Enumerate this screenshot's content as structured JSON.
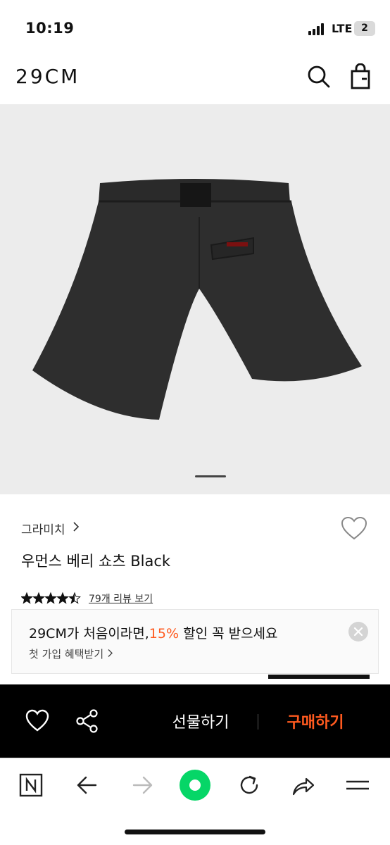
{
  "status_bar": {
    "time": "10:19",
    "network": "LTE",
    "battery": "2"
  },
  "header": {
    "logo": "29CM"
  },
  "product": {
    "brand": "그라미치",
    "name": "우먼스 베리 쇼츠 Black",
    "rating": 4.5,
    "review_link": "79개 리뷰 보기",
    "carousel_index": 1
  },
  "promo": {
    "title_prefix": "29CM가 처음이라면,",
    "title_highlight": "15%",
    "title_suffix": " 할인 꼭 받으세요",
    "subtitle": "첫 가입 혜택받기"
  },
  "action_bar": {
    "gift_label": "선물하기",
    "buy_label": "구매하기"
  },
  "colors": {
    "accent": "#ff5a1f",
    "action_bar_bg": "#000000",
    "image_bg": "#ececec"
  }
}
